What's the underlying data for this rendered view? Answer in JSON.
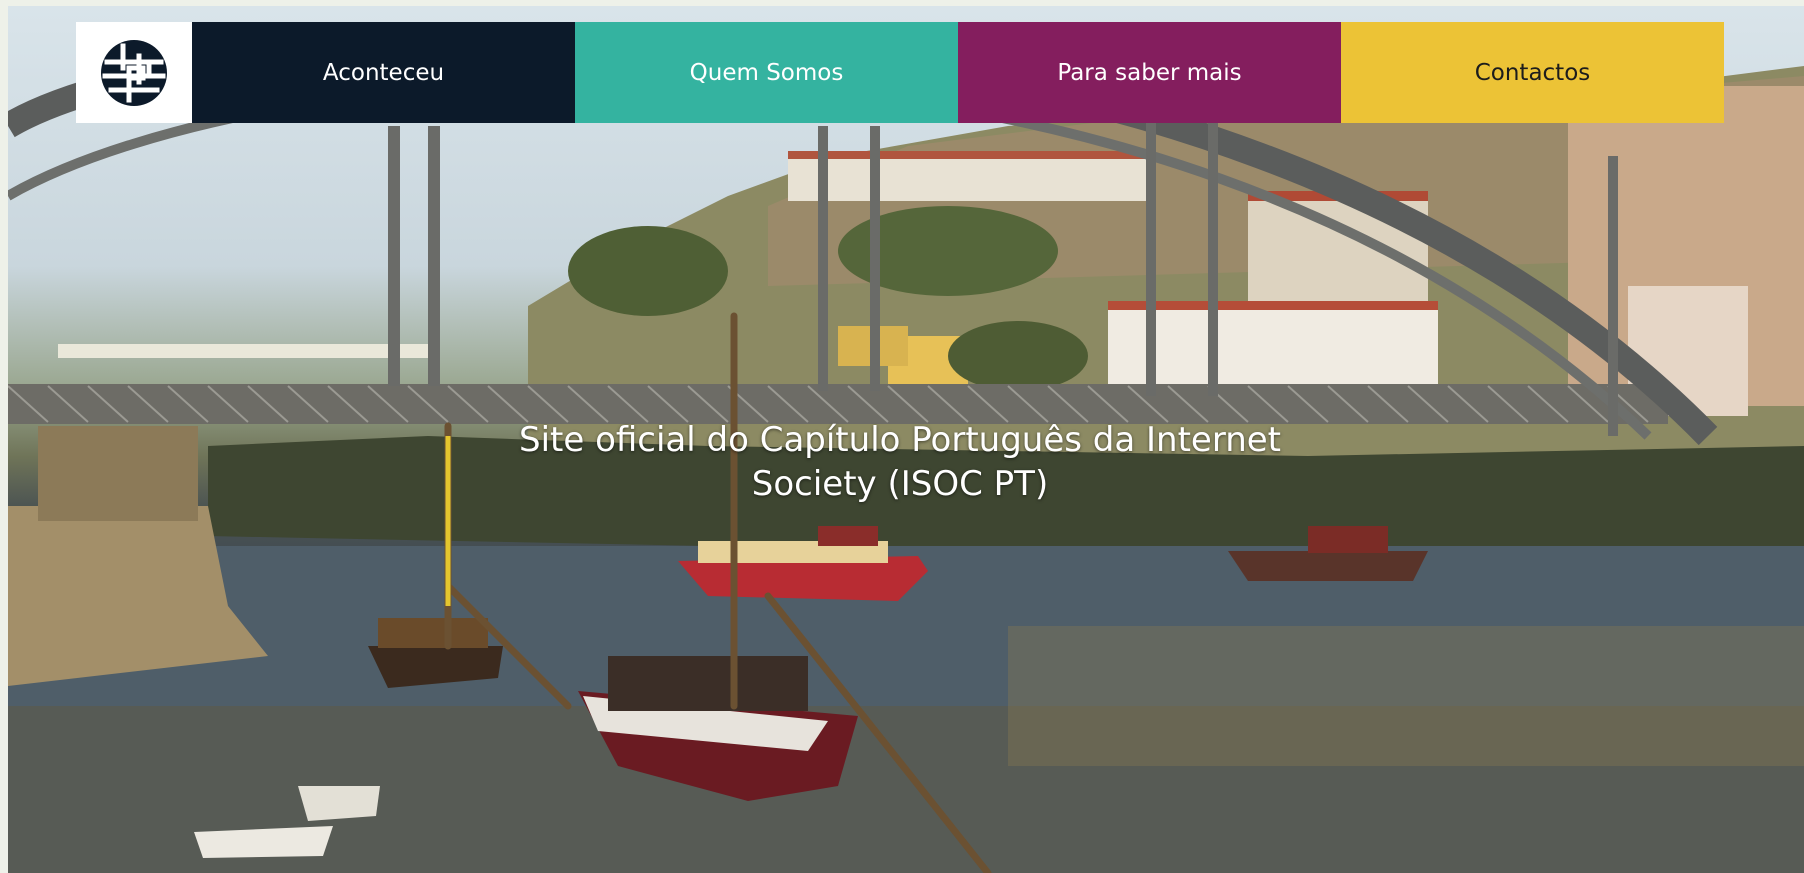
{
  "site": {
    "logo_icon": "isoc-globe-logo-icon"
  },
  "nav": {
    "items": [
      {
        "label": "Aconteceu",
        "color": "#0c1a2a"
      },
      {
        "label": "Quem Somos",
        "color": "#34b3a0"
      },
      {
        "label": "Para saber mais",
        "color": "#841e5e"
      },
      {
        "label": "Contactos",
        "color": "#ecc336"
      }
    ]
  },
  "hero": {
    "title": "Site oficial do Capítulo Português da Internet Society (ISOC PT)",
    "image_subject": "river-bridge-boats-photo"
  }
}
